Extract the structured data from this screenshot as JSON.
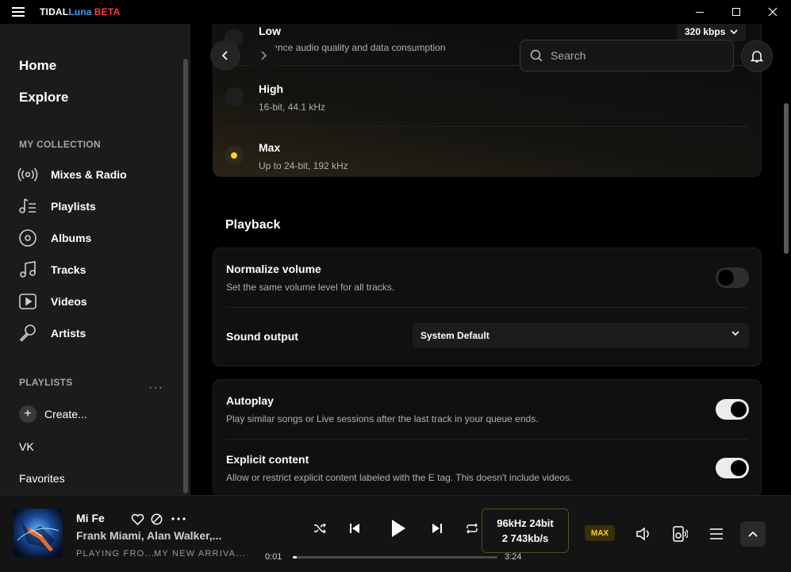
{
  "app": {
    "title_part1": "TIDAL",
    "title_part2": "Luna",
    "title_part3": "BETA"
  },
  "sidebar": {
    "home": "Home",
    "explore": "Explore",
    "collection_label": "MY COLLECTION",
    "collection": [
      {
        "label": "Mixes & Radio",
        "icon": "radio-icon"
      },
      {
        "label": "Playlists",
        "icon": "playlist-icon"
      },
      {
        "label": "Albums",
        "icon": "album-icon"
      },
      {
        "label": "Tracks",
        "icon": "music-note-icon"
      },
      {
        "label": "Videos",
        "icon": "video-icon"
      },
      {
        "label": "Artists",
        "icon": "microphone-icon"
      }
    ],
    "playlists_label": "PLAYLISTS",
    "more": "···",
    "create": "Create...",
    "playlists": [
      "VK",
      "Favorites"
    ]
  },
  "header": {
    "search_placeholder": "Search",
    "bitrate": "320 kbps"
  },
  "quality": {
    "options": [
      {
        "title": "Low",
        "sub": "Balance audio quality and data consumption",
        "selected": false
      },
      {
        "title": "High",
        "sub": "16-bit, 44.1 kHz",
        "selected": false
      },
      {
        "title": "Max",
        "sub": "Up to 24-bit, 192 kHz",
        "selected": true
      }
    ]
  },
  "playback": {
    "heading": "Playback",
    "normalize_title": "Normalize volume",
    "normalize_sub": "Set the same volume level for all tracks.",
    "normalize_on": false,
    "sound_output_title": "Sound output",
    "sound_output_value": "System Default",
    "autoplay_title": "Autoplay",
    "autoplay_sub": "Play similar songs or Live sessions after the last track in your queue ends.",
    "autoplay_on": true,
    "explicit_title": "Explicit content",
    "explicit_sub": "Allow or restrict explicit content labeled with the E tag. This doesn't include videos.",
    "explicit_on": true
  },
  "player": {
    "track": "Mi Fe",
    "artist": "Frank Miami, Alan Walker,...",
    "playing_from": "PLAYING FRO...",
    "playlist": "MY NEW ARRIVA...",
    "sample_rate": "96kHz 24bit",
    "bitrate": "2 743kb/s",
    "badge": "MAX",
    "time_current": "0:01",
    "time_total": "3:24",
    "progress_fraction": 0.005,
    "colors": {
      "accent": "#ffd21f"
    }
  }
}
